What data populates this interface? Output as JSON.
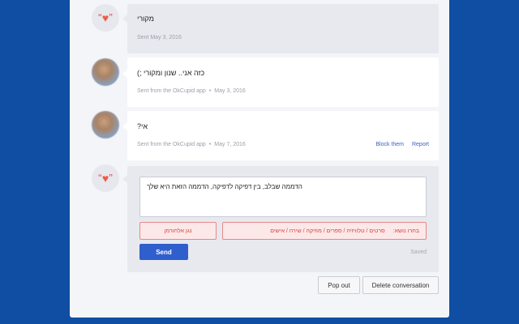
{
  "thread": {
    "messages": [
      {
        "text": "מקורי",
        "meta": "Sent May 3, 2016"
      },
      {
        "text": "כזה אני.. שנון ומקורי ;)",
        "source": "Sent from the OkCupid app",
        "date": "May 3, 2016"
      },
      {
        "text": "אי?",
        "source": "Sent from the OkCupid app",
        "date": "May 7, 2016"
      }
    ],
    "actions": {
      "block": "Block them",
      "report": "Report"
    }
  },
  "compose": {
    "draft": "הדממה שבלב, בין דפיקה לדפיקה, הדממה הזאת היא שלך",
    "topic_left": "נגן אלחורמן",
    "topic_label": "בחרו נושא:",
    "topic_options": "סרטים / טלוויזיה / ספרים / מוזיקה / שירה / אישים",
    "send_label": "Send",
    "saved_label": "Saved"
  },
  "footer": {
    "popout_label": "Pop out",
    "delete_label": "Delete conversation"
  },
  "icons": {
    "heart": "heart-icon",
    "accent": "#f25a45",
    "brand": "#2f5fcc"
  }
}
